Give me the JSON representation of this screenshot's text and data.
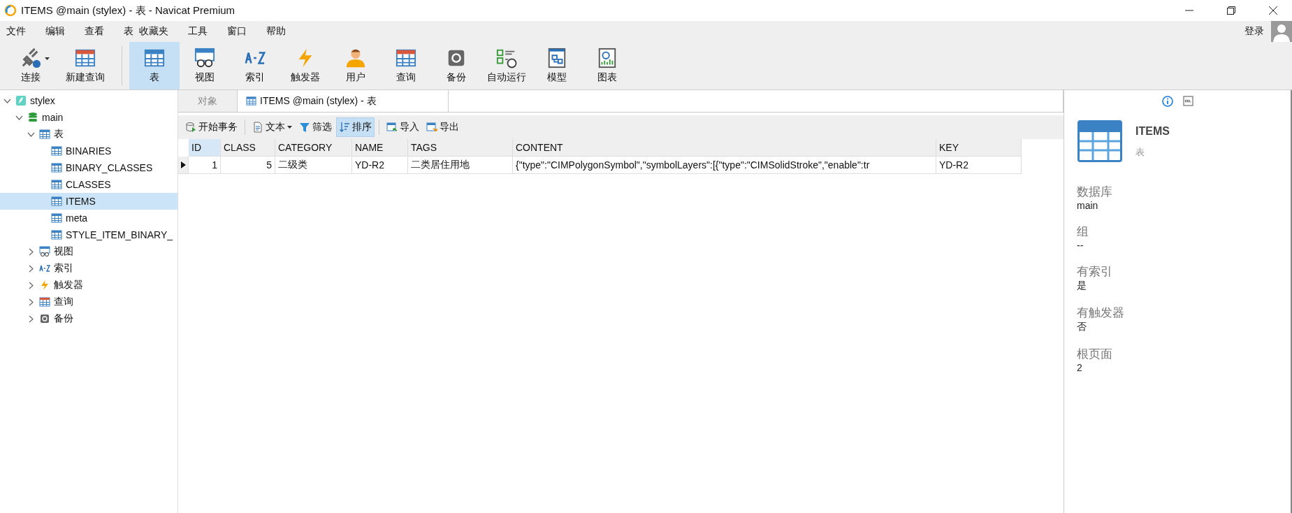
{
  "window": {
    "title": "ITEMS @main (stylex) - 表 - Navicat Premium"
  },
  "menu": [
    "文件",
    "编辑",
    "查看",
    "表",
    "收藏夹",
    "工具",
    "窗口",
    "帮助"
  ],
  "account": {
    "label": "登录"
  },
  "toolbar": [
    {
      "label": "连接",
      "kind": "connect",
      "selected": false
    },
    {
      "label": "新建查询",
      "kind": "newquery",
      "selected": false
    },
    {
      "label": "表",
      "kind": "table",
      "selected": true
    },
    {
      "label": "视图",
      "kind": "view",
      "selected": false
    },
    {
      "label": "索引",
      "kind": "index",
      "selected": false
    },
    {
      "label": "触发器",
      "kind": "trigger",
      "selected": false
    },
    {
      "label": "用户",
      "kind": "user",
      "selected": false
    },
    {
      "label": "查询",
      "kind": "query",
      "selected": false
    },
    {
      "label": "备份",
      "kind": "backup",
      "selected": false
    },
    {
      "label": "自动运行",
      "kind": "auto",
      "selected": false
    },
    {
      "label": "模型",
      "kind": "model",
      "selected": false
    },
    {
      "label": "图表",
      "kind": "chart",
      "selected": false
    }
  ],
  "tree": [
    {
      "label": "stylex",
      "kind": "connection",
      "expanded": true,
      "selected": false,
      "children": [
        {
          "label": "main",
          "kind": "database",
          "expanded": true,
          "selected": false,
          "children": [
            {
              "label": "表",
              "kind": "table",
              "expanded": true,
              "selected": false,
              "children": [
                {
                  "label": "BINARIES",
                  "kind": "table",
                  "selected": false
                },
                {
                  "label": "BINARY_CLASSES",
                  "kind": "table",
                  "selected": false
                },
                {
                  "label": "CLASSES",
                  "kind": "table",
                  "selected": false
                },
                {
                  "label": "ITEMS",
                  "kind": "table",
                  "selected": true
                },
                {
                  "label": "meta",
                  "kind": "table",
                  "selected": false
                },
                {
                  "label": "STYLE_ITEM_BINARY_",
                  "kind": "table",
                  "selected": false
                }
              ]
            },
            {
              "label": "视图",
              "kind": "view",
              "expanded": false,
              "selected": false
            },
            {
              "label": "索引",
              "kind": "index",
              "expanded": false,
              "selected": false
            },
            {
              "label": "触发器",
              "kind": "trigger",
              "expanded": false,
              "selected": false
            },
            {
              "label": "查询",
              "kind": "query",
              "expanded": false,
              "selected": false
            },
            {
              "label": "备份",
              "kind": "backup",
              "expanded": false,
              "selected": false
            }
          ]
        }
      ]
    }
  ],
  "tabs": [
    {
      "label": "对象",
      "kind": "plain",
      "selected": false
    },
    {
      "label": "ITEMS @main (stylex) - 表",
      "kind": "table",
      "selected": true
    }
  ],
  "actions": [
    {
      "label": "开始事务",
      "kind": "transaction",
      "dropdown": false,
      "selected": false
    },
    {
      "label": "文本",
      "kind": "text",
      "dropdown": true,
      "selected": false
    },
    {
      "label": "筛选",
      "kind": "filter",
      "dropdown": false,
      "selected": false
    },
    {
      "label": "排序",
      "kind": "sort",
      "dropdown": false,
      "selected": true
    },
    {
      "label": "导入",
      "kind": "import",
      "dropdown": false,
      "selected": false
    },
    {
      "label": "导出",
      "kind": "export",
      "dropdown": false,
      "selected": false
    }
  ],
  "table": {
    "columns": [
      "ID",
      "CLASS",
      "CATEGORY",
      "NAME",
      "TAGS",
      "CONTENT",
      "KEY"
    ],
    "rows": [
      {
        "selected": true,
        "cells": [
          "1",
          "5",
          "二级类",
          "YD-R2",
          "二类居住用地",
          "{\"type\":\"CIMPolygonSymbol\",\"symbolLayers\":[{\"type\":\"CIMSolidStroke\",\"enable\":tr",
          "YD-R2"
        ]
      }
    ]
  },
  "info": {
    "name": "ITEMS",
    "type": "表",
    "fields": [
      {
        "label": "数据库",
        "value": "main"
      },
      {
        "label": "组",
        "value": "--"
      },
      {
        "label": "有索引",
        "value": "是"
      },
      {
        "label": "有触发器",
        "value": "否"
      },
      {
        "label": "根页面",
        "value": "2"
      }
    ]
  }
}
